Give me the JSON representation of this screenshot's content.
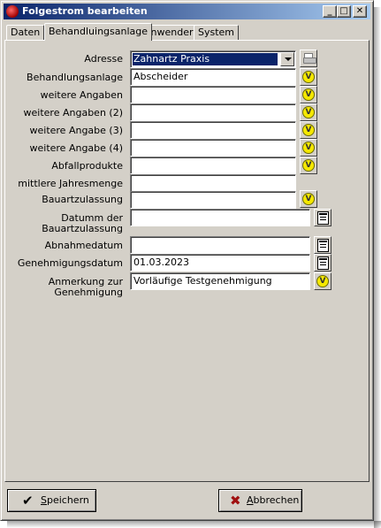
{
  "window": {
    "title": "Folgestrom bearbeiten"
  },
  "title_buttons": {
    "minimize": "_",
    "maximize": "□",
    "close": "✕"
  },
  "tabs": [
    {
      "label": "Daten",
      "active": false
    },
    {
      "label": "Behandluingsanlage",
      "active": true
    },
    {
      "label": "Anwender",
      "active": false
    },
    {
      "label": "System",
      "active": false
    }
  ],
  "form": {
    "adresse": {
      "label": "Adresse",
      "value": "Zahnartz Praxis"
    },
    "behandlungsanlage": {
      "label": "Behandlungsanlage",
      "value": "Abscheider"
    },
    "weitere_angaben": {
      "label": "weitere Angaben",
      "value": ""
    },
    "weitere_angaben_2": {
      "label": "weitere Angaben (2)",
      "value": ""
    },
    "weitere_angabe_3": {
      "label": "weitere Angabe (3)",
      "value": ""
    },
    "weitere_angabe_4": {
      "label": "weitere Angabe (4)",
      "value": ""
    },
    "abfallprodukte": {
      "label": "Abfallprodukte",
      "value": ""
    },
    "mittlere_jahresmenge": {
      "label": "mittlere Jahresmenge",
      "value": ""
    },
    "bauartzulassung": {
      "label": "Bauartzulassung",
      "value": ""
    },
    "datum_bauartzulassung": {
      "label_line1": "Datumm der",
      "label_line2": "Bauartzulassung",
      "value": ""
    },
    "abnahmedatum": {
      "label": "Abnahmedatum",
      "value": ""
    },
    "genehmigungsdatum": {
      "label": "Genehmigungsdatum",
      "value": "01.03.2023"
    },
    "anmerkung": {
      "label_line1": "Anmerkung zur",
      "label_line2": "Genehmigung",
      "value": "Vorläufige Testgenehmigung"
    }
  },
  "icons": {
    "v_glyph": "V"
  },
  "buttons": {
    "save": {
      "label_first": "S",
      "label_rest": "peichern"
    },
    "cancel": {
      "label_first": "A",
      "label_rest": "bbrechen"
    }
  },
  "colors": {
    "title_start": "#0a246a",
    "title_end": "#a6caf0",
    "face": "#d4d0c8",
    "v_icon": "#f5e800",
    "cancel_icon": "#a01010",
    "save_icon": "#000000"
  }
}
